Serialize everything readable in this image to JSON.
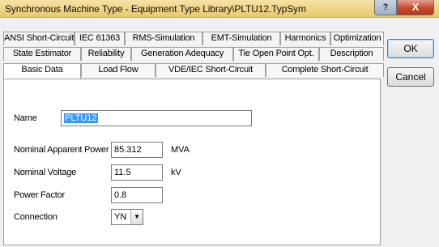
{
  "window": {
    "title": "Synchronous Machine Type - Equipment Type Library\\PLTU12.TypSym",
    "help_label": "?",
    "close_label": "X"
  },
  "tabs": {
    "row1": [
      "ANSI Short-Circuit",
      "IEC 61363",
      "RMS-Simulation",
      "EMT-Simulation",
      "Harmonics",
      "Optimization"
    ],
    "row2": [
      "State Estimator",
      "Reliability",
      "Generation Adequacy",
      "Tie Open Point Opt.",
      "Description"
    ],
    "row3": [
      "Basic Data",
      "Load Flow",
      "VDE/IEC Short-Circuit",
      "Complete Short-Circuit"
    ],
    "active": "Basic Data"
  },
  "form": {
    "name_label": "Name",
    "name_value": "PLTU12",
    "nominal_apparent_power_label": "Nominal Apparent Power",
    "nominal_apparent_power_value": "85.312",
    "nominal_apparent_power_unit": "MVA",
    "nominal_voltage_label": "Nominal Voltage",
    "nominal_voltage_value": "11.5",
    "nominal_voltage_unit": "kV",
    "power_factor_label": "Power Factor",
    "power_factor_value": "0.8",
    "connection_label": "Connection",
    "connection_value": "YN"
  },
  "buttons": {
    "ok_label": "OK",
    "cancel_label": "Cancel"
  },
  "icons": {
    "combo_arrow": "chevron-down-icon"
  }
}
